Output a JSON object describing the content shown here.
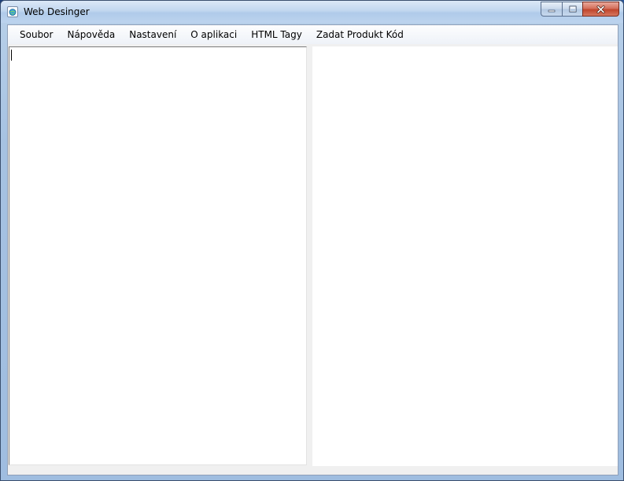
{
  "window": {
    "title": "Web Desinger",
    "app_icon": "globe-document-icon",
    "minimize_icon": "minimize-icon",
    "maximize_icon": "maximize-icon",
    "close_icon": "close-icon"
  },
  "menu": {
    "items": [
      {
        "label": "Soubor"
      },
      {
        "label": "Nápověda"
      },
      {
        "label": "Nastavení"
      },
      {
        "label": "O aplikaci"
      },
      {
        "label": "HTML Tagy"
      },
      {
        "label": "Zadat Produkt Kód"
      }
    ]
  },
  "editor": {
    "content": ""
  },
  "preview": {
    "content": ""
  },
  "colors": {
    "titlebar": "#c2d7ef",
    "close_button": "#c0452c",
    "client_background": "#f0f0f0",
    "pane_background": "#ffffff"
  }
}
